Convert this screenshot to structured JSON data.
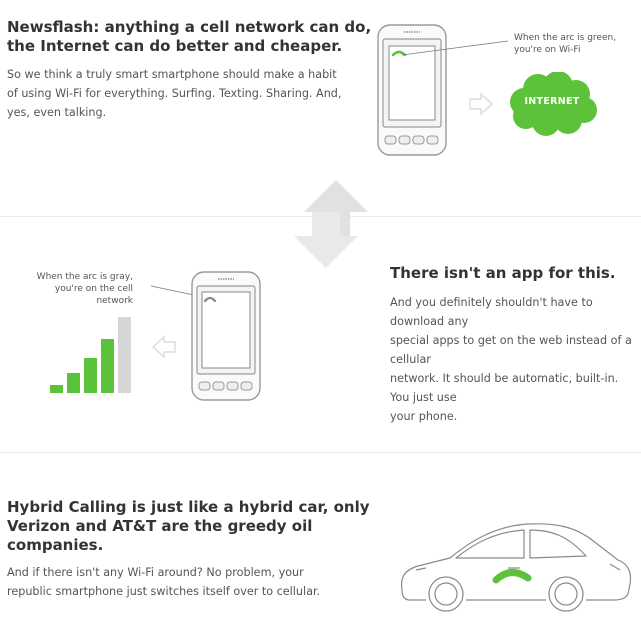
{
  "section1": {
    "heading_line1": "Newsflash: anything a cell network can do,",
    "heading_line2": "the Internet can do better and cheaper.",
    "body_lines": [
      "So we think a truly smart smartphone should make a habit",
      "of using Wi-Fi for everything. Surfing. Texting. Sharing. And,",
      "yes, even talking."
    ],
    "callout_line1": "When the arc is green,",
    "callout_line2": "you're on Wi-Fi",
    "cloud_label": "INTERNET"
  },
  "section2": {
    "callout_line1": "When the arc is gray,",
    "callout_line2": "you're on the cell network",
    "heading": "There isn't an app for this.",
    "body_lines": [
      "And you definitely shouldn't have to download any",
      "special apps to get on the web instead of a cellular",
      "network. It should be automatic, built-in. You just use",
      "your phone."
    ]
  },
  "section3": {
    "heading_lines": [
      "Hybrid Calling is just like a hybrid car, only",
      "Verizon and AT&T are the greedy oil",
      "companies."
    ],
    "body_lines": [
      "And if there isn't any Wi-Fi around? No problem, your",
      "republic smartphone just switches itself over to cellular."
    ]
  },
  "colors": {
    "wifi_green": "#5cc23a",
    "cell_gray": "#d6d6d6",
    "arrow_gray": "#e1e1e1",
    "divider": "#ececec"
  },
  "signal_bars": [
    {
      "state": "on"
    },
    {
      "state": "on"
    },
    {
      "state": "on"
    },
    {
      "state": "on"
    },
    {
      "state": "off"
    }
  ]
}
